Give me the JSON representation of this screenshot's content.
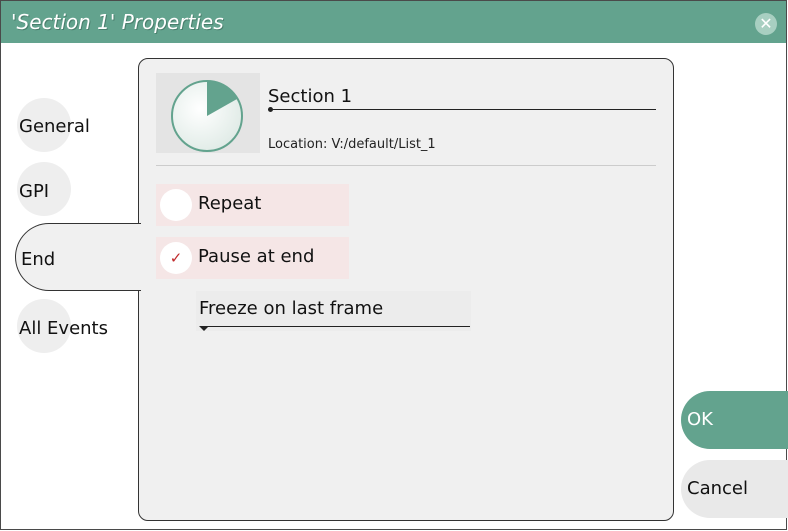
{
  "window": {
    "title": "'Section 1' Properties",
    "close_label": "✕"
  },
  "tabs": [
    {
      "label": "General",
      "selected": false
    },
    {
      "label": "GPI",
      "selected": false
    },
    {
      "label": "End",
      "selected": true
    },
    {
      "label": "All Events",
      "selected": false
    }
  ],
  "section": {
    "name": "Section 1",
    "location": "Location: V:/default/List_1",
    "icon": "pie-timer-icon"
  },
  "options": {
    "repeat": {
      "label": "Repeat",
      "checked": false
    },
    "pause_at_end": {
      "label": "Pause at end",
      "checked": true,
      "check_glyph": "✓"
    }
  },
  "end_action": {
    "selected": "Freeze on last frame"
  },
  "buttons": {
    "ok": "OK",
    "cancel": "Cancel"
  },
  "colors": {
    "accent": "#63a38e",
    "check": "#c0292b",
    "panel_bg": "#f0f0f0"
  }
}
